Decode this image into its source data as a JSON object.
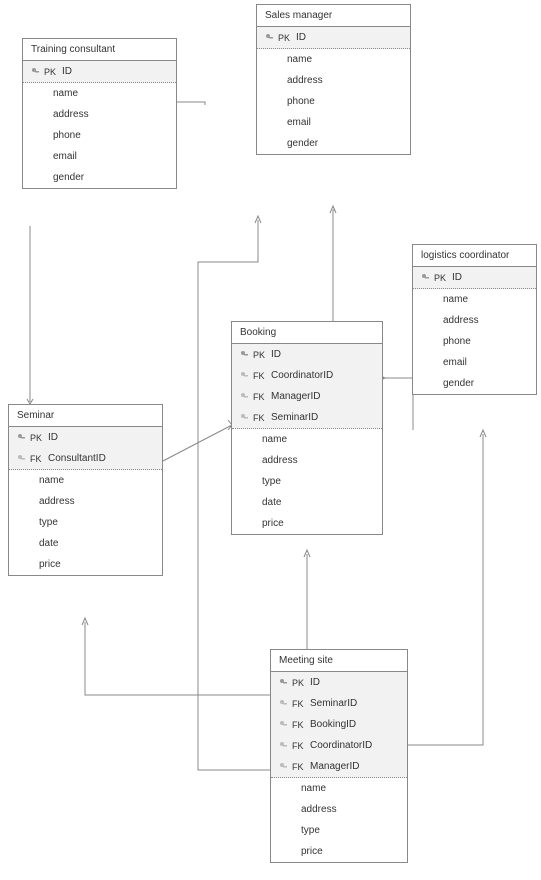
{
  "entities": {
    "training_consultant": {
      "title": "Training consultant",
      "pk": "ID",
      "attrs": [
        "name",
        "address",
        "phone",
        "email",
        "gender"
      ]
    },
    "sales_manager": {
      "title": "Sales manager",
      "pk": "ID",
      "attrs": [
        "name",
        "address",
        "phone",
        "email",
        "gender"
      ]
    },
    "logistics_coordinator": {
      "title": "logistics coordinator",
      "pk": "ID",
      "attrs": [
        "name",
        "address",
        "phone",
        "email",
        "gender"
      ]
    },
    "seminar": {
      "title": "Seminar",
      "pk": "ID",
      "fks": [
        "ConsultantID"
      ],
      "attrs": [
        "name",
        "address",
        "type",
        "date",
        "price"
      ]
    },
    "booking": {
      "title": "Booking",
      "pk": "ID",
      "fks": [
        "CoordinatorID",
        "ManagerID",
        "SeminarID"
      ],
      "attrs": [
        "name",
        "address",
        "type",
        "date",
        "price"
      ]
    },
    "meeting_site": {
      "title": "Meeting site",
      "pk": "ID",
      "fks": [
        "SeminarID",
        "BookingID",
        "CoordinatorID",
        "ManagerID"
      ],
      "attrs": [
        "name",
        "address",
        "type",
        "price"
      ]
    }
  },
  "labels": {
    "pk": "PK",
    "fk": "FK"
  }
}
